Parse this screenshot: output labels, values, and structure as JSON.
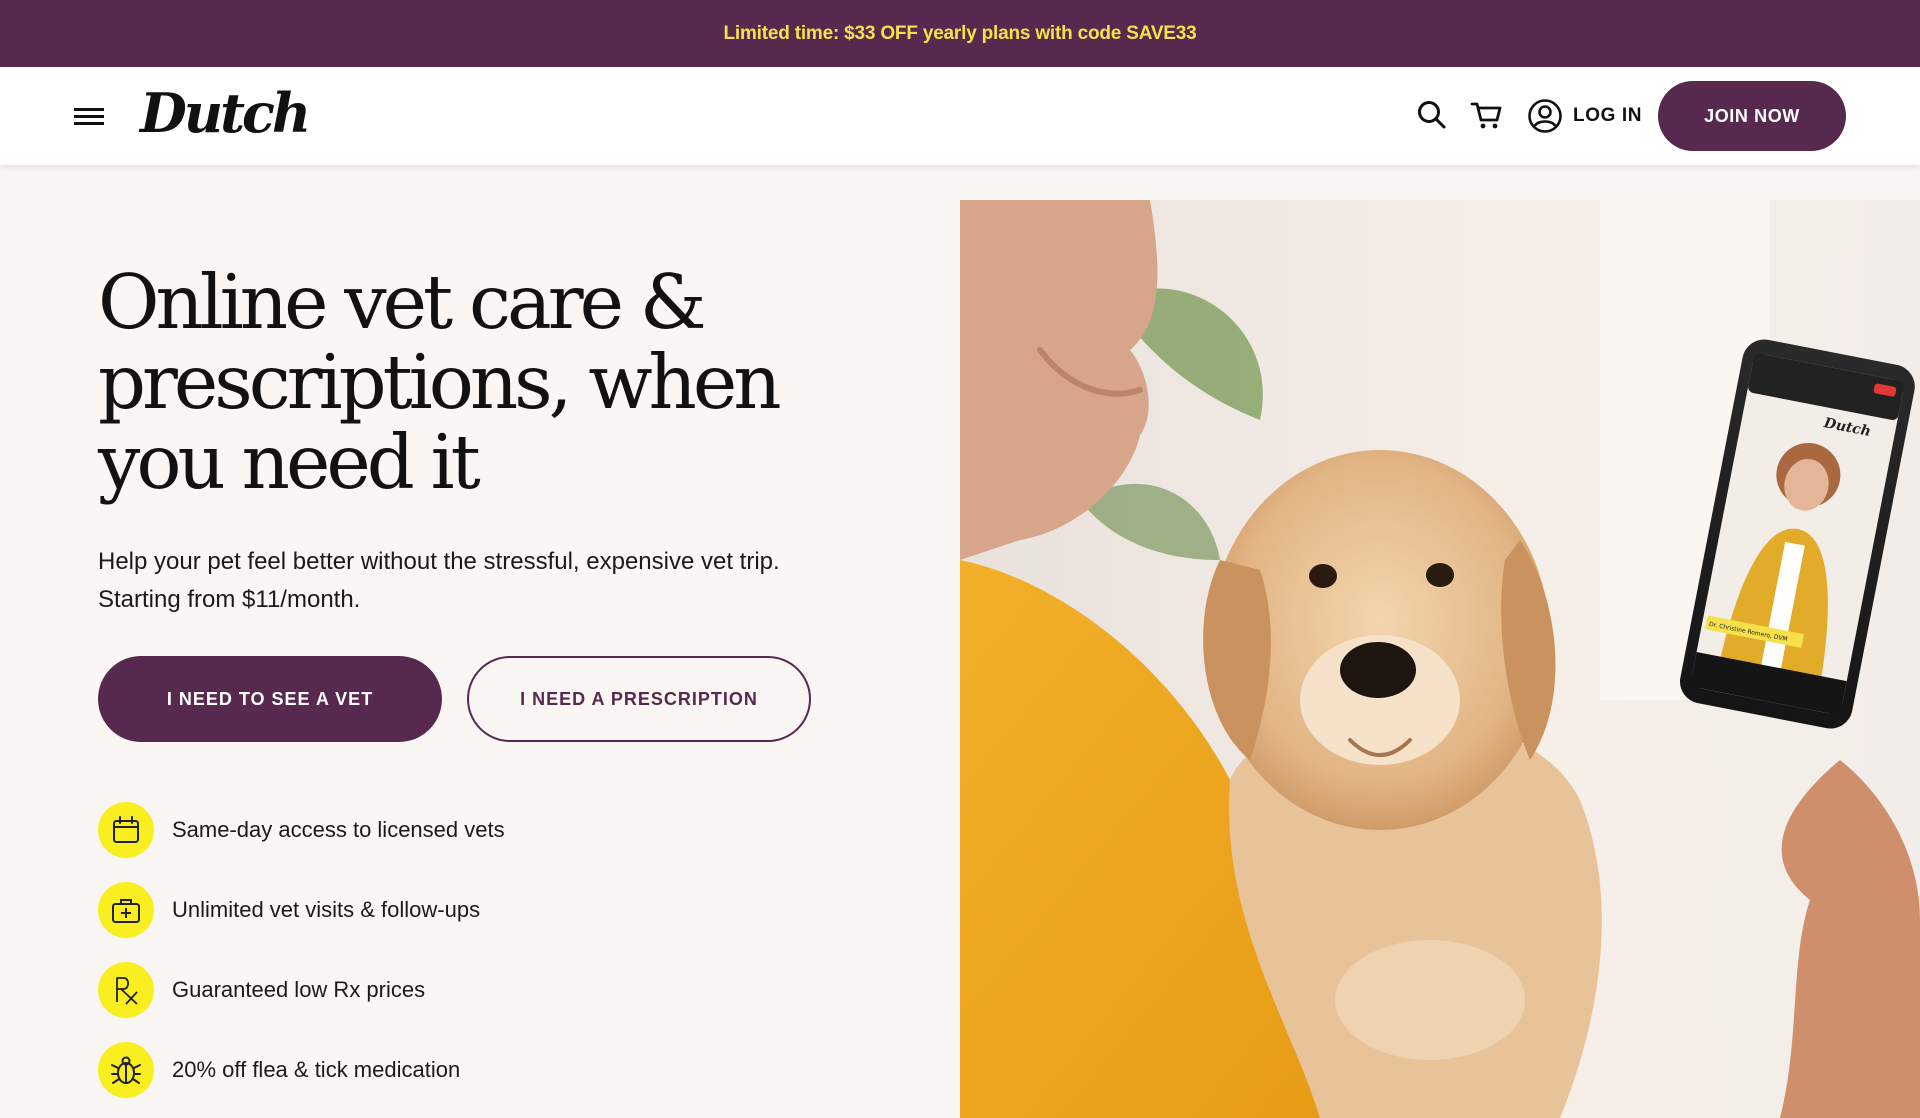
{
  "promo": {
    "text": "Limited time: $33 OFF yearly plans with code SAVE33"
  },
  "header": {
    "logo": "Dutch",
    "login_label": "LOG IN",
    "join_label": "JOIN NOW",
    "icons": [
      "menu-icon",
      "search-icon",
      "cart-icon",
      "user-icon"
    ]
  },
  "hero": {
    "title": "Online vet care & prescriptions, when you need it",
    "subtitle_line1": "Help your pet feel better without the stressful, expensive vet trip.",
    "subtitle_line2": "Starting from $11/month.",
    "cta_primary": "I NEED TO SEE A VET",
    "cta_secondary": "I NEED A PRESCRIPTION"
  },
  "features": [
    {
      "icon": "calendar-icon",
      "text": "Same-day access to licensed vets"
    },
    {
      "icon": "medical-kit-icon",
      "text": "Unlimited vet visits & follow-ups"
    },
    {
      "icon": "rx-icon",
      "text": "Guaranteed low Rx prices"
    },
    {
      "icon": "bug-icon",
      "text": "20% off flea & tick medication"
    }
  ],
  "photo": {
    "phone_logo": "Dutch",
    "phone_caption": "Dr. Christine Romero, DVM"
  },
  "colors": {
    "brand_purple": "#57294e",
    "promo_text_yellow": "#f7e04a",
    "icon_yellow": "#f9ee1f",
    "page_background": "#f9f6f4"
  }
}
